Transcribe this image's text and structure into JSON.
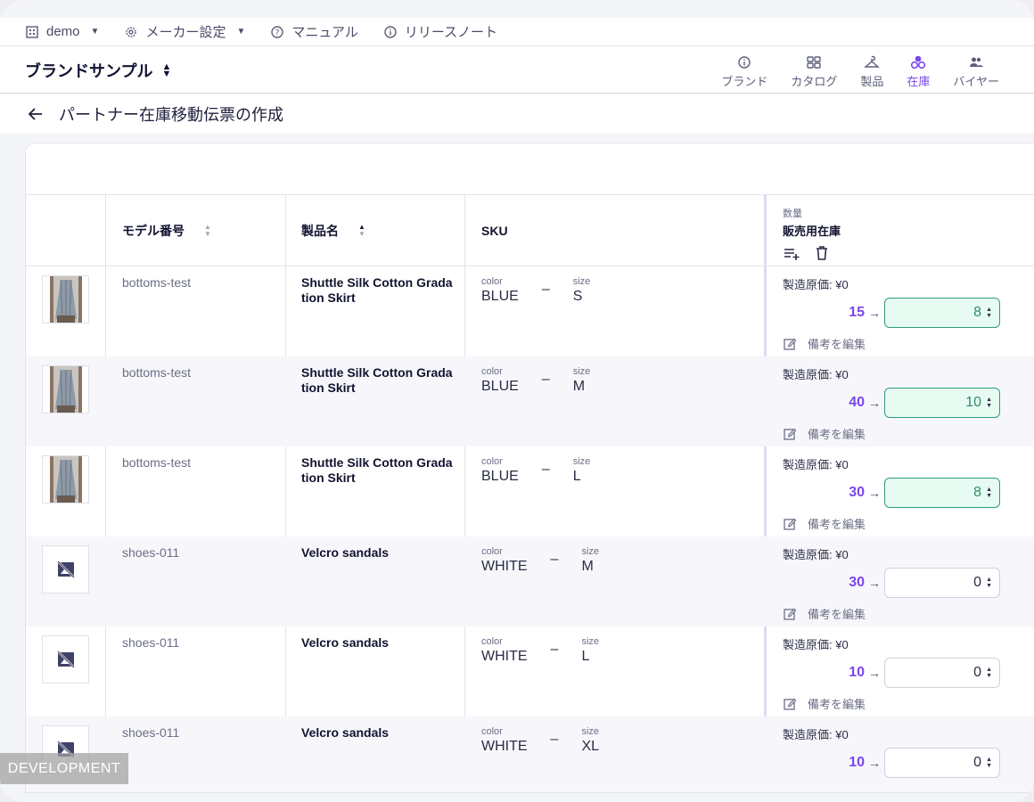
{
  "topbar": {
    "org": "demo",
    "maker_settings": "メーカー設定",
    "manual": "マニュアル",
    "release_notes": "リリースノート"
  },
  "header": {
    "brand_name": "ブランドサンプル",
    "nav": [
      {
        "label": "ブランド",
        "icon": "info-icon"
      },
      {
        "label": "カタログ",
        "icon": "grid-icon"
      },
      {
        "label": "製品",
        "icon": "hanger-icon"
      },
      {
        "label": "在庫",
        "icon": "boxes-icon",
        "active": true
      },
      {
        "label": "バイヤー",
        "icon": "people-icon"
      }
    ]
  },
  "page": {
    "title": "パートナー在庫移動伝票の作成"
  },
  "table": {
    "headers": {
      "model": "モデル番号",
      "product": "製品名",
      "sku": "SKU",
      "qty_small": "数量",
      "qty_big": "販売用在庫"
    },
    "rows": [
      {
        "model": "bottoms-test",
        "product": "Shuttle Silk Cotton Gradation Skirt",
        "color_label": "color",
        "color": "BLUE",
        "size_label": "size",
        "size": "S",
        "cost": "製造原価: ¥0",
        "from": "15",
        "to": "8",
        "changed": true,
        "note": "備考を編集",
        "has_image": true
      },
      {
        "model": "bottoms-test",
        "product": "Shuttle Silk Cotton Gradation Skirt",
        "color_label": "color",
        "color": "BLUE",
        "size_label": "size",
        "size": "M",
        "cost": "製造原価: ¥0",
        "from": "40",
        "to": "10",
        "changed": true,
        "note": "備考を編集",
        "has_image": true
      },
      {
        "model": "bottoms-test",
        "product": "Shuttle Silk Cotton Gradation Skirt",
        "color_label": "color",
        "color": "BLUE",
        "size_label": "size",
        "size": "L",
        "cost": "製造原価: ¥0",
        "from": "30",
        "to": "8",
        "changed": true,
        "note": "備考を編集",
        "has_image": true
      },
      {
        "model": "shoes-011",
        "product": "Velcro sandals",
        "color_label": "color",
        "color": "WHITE",
        "size_label": "size",
        "size": "M",
        "cost": "製造原価: ¥0",
        "from": "30",
        "to": "0",
        "changed": false,
        "note": "備考を編集",
        "has_image": false
      },
      {
        "model": "shoes-011",
        "product": "Velcro sandals",
        "color_label": "color",
        "color": "WHITE",
        "size_label": "size",
        "size": "L",
        "cost": "製造原価: ¥0",
        "from": "10",
        "to": "0",
        "changed": false,
        "note": "備考を編集",
        "has_image": false
      },
      {
        "model": "shoes-011",
        "product": "Velcro sandals",
        "color_label": "color",
        "color": "WHITE",
        "size_label": "size",
        "size": "XL",
        "cost": "製造原価: ¥0",
        "from": "10",
        "to": "0",
        "changed": false,
        "note": "",
        "has_image": false
      }
    ]
  },
  "badge": {
    "environment": "DEVELOPMENT"
  },
  "colors": {
    "accent": "#7b46ee",
    "changed_bg": "#e7fbf3",
    "changed_border": "#2e9b7c"
  }
}
